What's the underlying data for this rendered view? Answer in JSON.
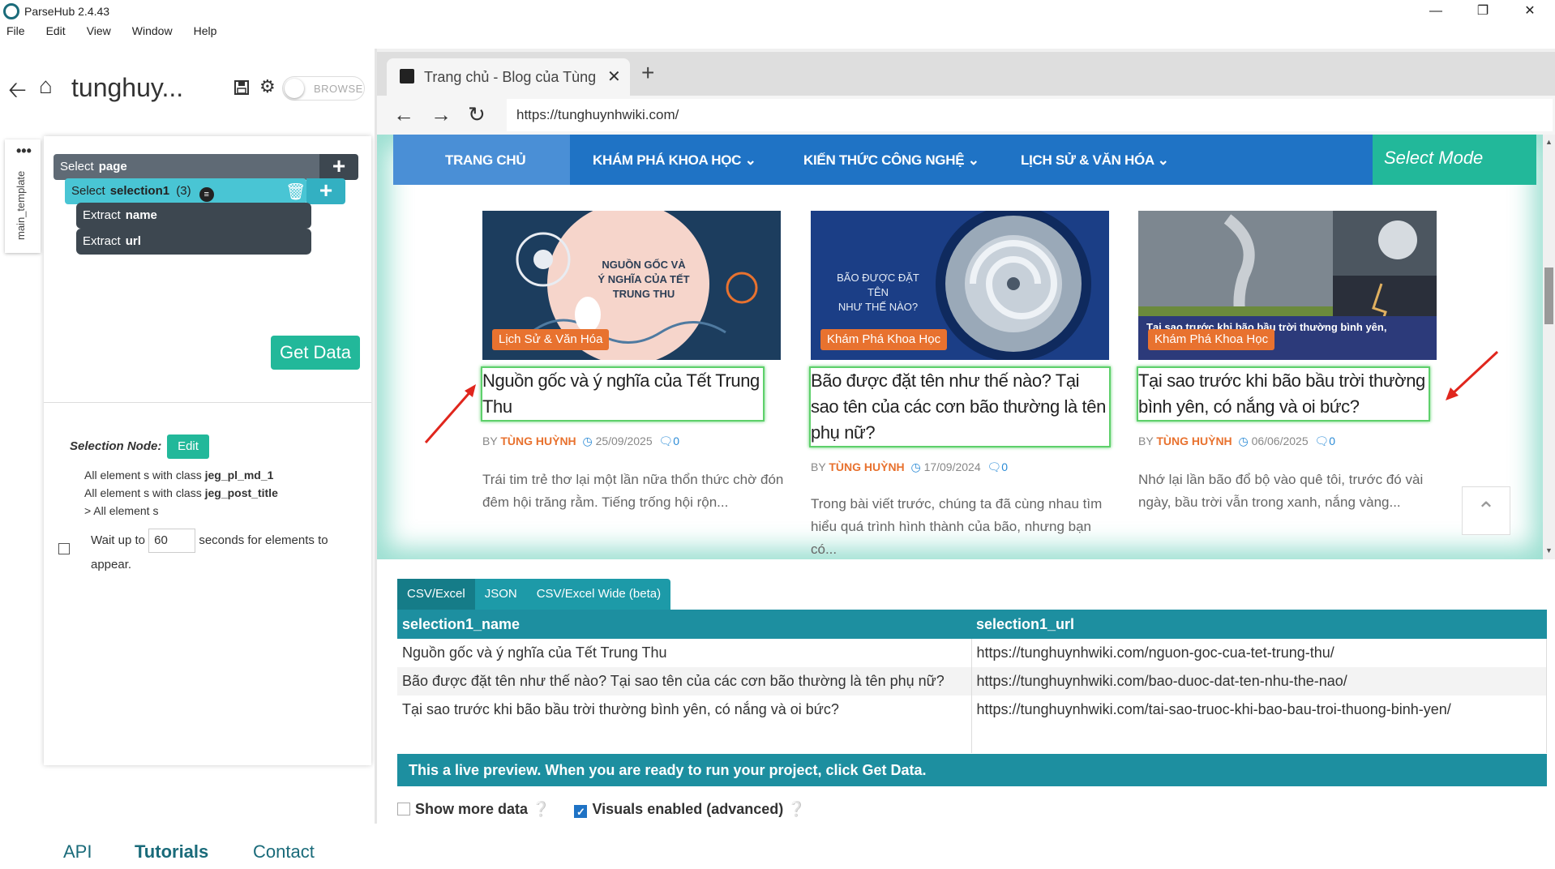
{
  "window": {
    "title": "ParseHub 2.4.43"
  },
  "menu": [
    "File",
    "Edit",
    "View",
    "Window",
    "Help"
  ],
  "left": {
    "project_title": "tunghuy...",
    "toggle_label": "BROWSE",
    "template_tab": "main_template",
    "commands": {
      "select_page": {
        "verb": "Select",
        "target": "page"
      },
      "select_selection": {
        "verb": "Select",
        "target": "selection1",
        "count": "(3)"
      },
      "extract_name": {
        "verb": "Extract",
        "target": "name"
      },
      "extract_url": {
        "verb": "Extract",
        "target": "url"
      }
    },
    "get_data": "Get Data",
    "selection_node_label": "Selection Node:",
    "edit": "Edit",
    "sel_lines": [
      {
        "pre": "All element s with class ",
        "cls": "jeg_pl_md_1"
      },
      {
        "pre": "All element s with class ",
        "cls": "jeg_post_title"
      },
      {
        "pre": "> All element s",
        "cls": ""
      }
    ],
    "wait": {
      "pre": "Wait up to",
      "value": "60",
      "post": "seconds for elements to appear."
    },
    "footer": [
      "API",
      "Tutorials",
      "Contact"
    ]
  },
  "browser": {
    "tab_title": "Trang chủ - Blog của Tùng",
    "url": "https://tunghuynhwiki.com/",
    "nav": [
      "TRANG CHỦ",
      "KHÁM PHÁ KHOA HỌC",
      "KIẾN THỨC CÔNG NGHỆ",
      "LỊCH SỬ & VĂN HÓA"
    ],
    "select_mode": "Select Mode",
    "posts": [
      {
        "thumb_text": [
          "NGUỒN GỐC VÀ",
          "Ý NGHĨA CỦA TẾT",
          "TRUNG THU"
        ],
        "category": "Lịch Sử & Văn Hóa",
        "title": "Nguồn gốc và ý nghĩa của Tết Trung Thu",
        "by": "BY",
        "author": "TÙNG HUỲNH",
        "date": "25/09/2025",
        "comments": "0",
        "excerpt": "Trái tim trẻ thơ lại một lần nữa thổn thức chờ đón đêm hội trăng rằm. Tiếng trống hội rộn..."
      },
      {
        "thumb_text": [
          "BÃO ĐƯỢC ĐẶT TÊN",
          "NHƯ THẾ NÀO?"
        ],
        "category": "Khám Phá Khoa Học",
        "title": "Bão được đặt tên như thế nào? Tại sao tên của các cơn bão thường là tên phụ nữ?",
        "by": "BY",
        "author": "TÙNG HUỲNH",
        "date": "17/09/2024",
        "comments": "0",
        "excerpt": "Trong bài viết trước, chúng ta đã cùng nhau tìm hiểu quá trình hình thành của bão, nhưng bạn có..."
      },
      {
        "thumb_text": [
          "Tại sao trước khi bão bầu trời thường bình yên,"
        ],
        "category": "Khám Phá Khoa Học",
        "title": "Tại sao trước khi bão bầu trời thường bình yên, có nắng và oi bức?",
        "by": "BY",
        "author": "TÙNG HUỲNH",
        "date": "06/06/2025",
        "comments": "0",
        "excerpt": "Nhớ lại lần bão đổ bộ vào quê tôi, trước đó vài ngày, bầu trời vẫn trong xanh, nắng vàng..."
      }
    ]
  },
  "preview": {
    "tabs": [
      "CSV/Excel",
      "JSON",
      "CSV/Excel Wide (beta)"
    ],
    "columns": [
      "selection1_name",
      "selection1_url"
    ],
    "rows": [
      [
        "Nguồn gốc và ý nghĩa của Tết Trung Thu",
        "https://tunghuynhwiki.com/nguon-goc-cua-tet-trung-thu/"
      ],
      [
        "Bão được đặt tên như thế nào? Tại sao tên của các cơn bão thường là tên phụ nữ?",
        "https://tunghuynhwiki.com/bao-duoc-dat-ten-nhu-the-nao/"
      ],
      [
        "Tại sao trước khi bão bầu trời thường bình yên, có nắng và oi bức?",
        "https://tunghuynhwiki.com/tai-sao-truoc-khi-bao-bau-troi-thuong-binh-yen/"
      ]
    ],
    "live_note": "This a live preview. When you are ready to run your project, click Get Data.",
    "show_more": "Show more data",
    "visuals": "Visuals enabled (advanced)"
  },
  "colors": {
    "teal": "#22b89a",
    "site_blue": "#1f73c5",
    "accent_orange": "#e8722f",
    "table_header": "#1d8fa0"
  }
}
